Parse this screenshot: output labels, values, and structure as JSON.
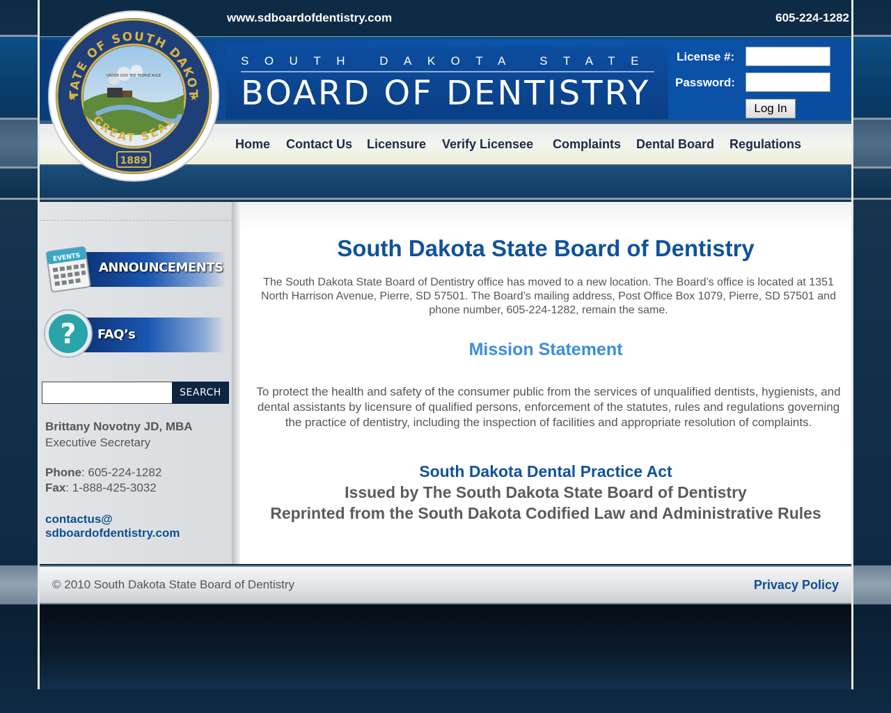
{
  "topbar": {
    "site_url": "www.sdboardofdentistry.com",
    "phone": "605-224-1282"
  },
  "header": {
    "state_line": "SOUTH DAKOTA STATE",
    "board_title": "BOARD OF DENTISTRY",
    "seal": {
      "top_text": "STATE OF SOUTH DAKOTA",
      "bottom_text": "GREAT SEAL",
      "year": "1889",
      "motto": "UNDER GOD THE PEOPLE RULE"
    }
  },
  "login": {
    "license_label": "License #:",
    "password_label": "Password:",
    "license_value": "",
    "password_value": "",
    "button_label": "Log In"
  },
  "nav": {
    "items": [
      "Home",
      "Contact Us",
      "Licensure",
      "Verify Licensee",
      "Complaints",
      "Dental Board",
      "Regulations"
    ]
  },
  "sidebar": {
    "announcements": {
      "label": "ANNOUNCEMENTS",
      "calendar_label": "EVENTS"
    },
    "faqs": {
      "label": "FAQ’s",
      "icon_glyph": "?"
    },
    "search": {
      "value": "",
      "button_label": "SEARCH"
    },
    "contact": {
      "name": "Brittany Novotny JD, MBA",
      "role": "Executive Secretary",
      "phone_label": "Phone",
      "phone_value": ": 605-224-1282",
      "fax_label": "Fax",
      "fax_value": ": 1-888-425-3032",
      "email_line1": "contactus@",
      "email_line2": "sdboardofdentistry.com"
    }
  },
  "content": {
    "title": "South Dakota State Board of Dentistry",
    "intro": "The South Dakota State Board of Dentistry office has moved to a new location.  The Board’s office is located at 1351 North Harrison Avenue, Pierre, SD  57501.  The Board’s mailing address, Post Office Box 1079, Pierre, SD  57501 and phone number, 605-224-1282, remain the same.",
    "mission_heading": "Mission Statement",
    "mission_text": "To protect the health and safety of the consumer public from the services of unqualified dentists, hygienists, and dental assistants by licensure of qualified persons, enforcement of the statutes, rules and regulations governing the practice of dentistry, including the inspection of facilities and appropriate resolution of complaints.",
    "act_heading": "South Dakota Dental Practice Act",
    "act_line1": "Issued by The South Dakota State Board of Dentistry",
    "act_line2": "Reprinted from the South Dakota Codified Law and Administrative Rules"
  },
  "footer": {
    "copyright": "© 2010 South Dakota State Board of Dentistry",
    "privacy": "Privacy Policy"
  },
  "colors": {
    "brand_blue": "#0b55b0",
    "title_blue": "#10529b",
    "mission_blue": "#3b8ed9",
    "dark_navy": "#0e2b46"
  }
}
